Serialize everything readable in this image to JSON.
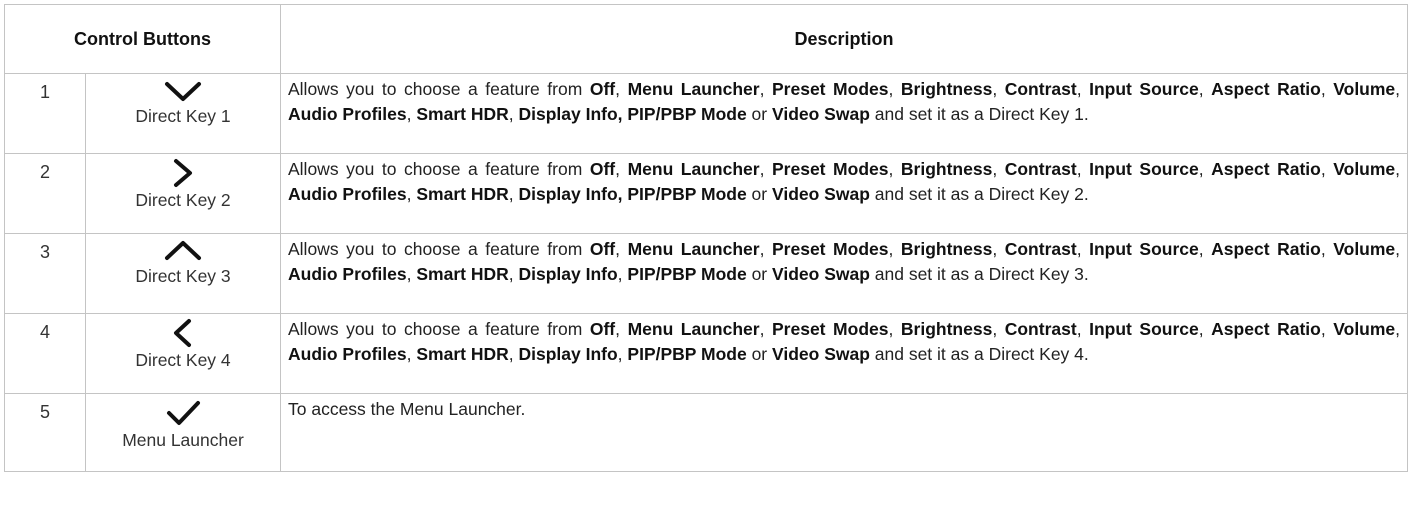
{
  "header": {
    "col_buttons": "Control Buttons",
    "col_description": "Description"
  },
  "rows": [
    {
      "num": "1",
      "icon": "chevron-down-icon",
      "button_label": "Direct Key 1",
      "prefix": "Allows you to choose a feature from ",
      "f1": "Off",
      "f2": "Menu Launcher",
      "f3": "Preset Modes",
      "f4": "Brightness",
      "f5": "Contrast",
      "f6": "Input Source",
      "f7": "Aspect Ratio",
      "f8": "Volume",
      "f9": "Audio Profiles",
      "f10": "Smart HDR",
      "f11": "Display Info, PIP/PBP Mode",
      "f12": "Video Swap",
      "suffix": " and set it as a Direct Key 1."
    },
    {
      "num": "2",
      "icon": "chevron-right-icon",
      "button_label": "Direct Key 2",
      "prefix": "Allows you to choose a feature from ",
      "f1": "Off",
      "f2": "Menu Launcher",
      "f3": "Preset Modes",
      "f4": "Brightness",
      "f5": "Contrast",
      "f6": "Input Source",
      "f7": "Aspect Ratio",
      "f8": "Volume",
      "f9": "Audio Profiles",
      "f10": "Smart HDR",
      "f11": "Display Info, PIP/PBP Mode",
      "f12": "Video Swap",
      "suffix": " and set it as a Direct Key 2."
    },
    {
      "num": "3",
      "icon": "chevron-up-icon",
      "button_label": "Direct Key 3",
      "prefix": "Allows you to choose a feature from ",
      "f1": "Off",
      "f2": "Menu Launcher",
      "f3": "Preset Modes",
      "f4": "Brightness",
      "f5": "Contrast",
      "f6": "Input Source",
      "f7": "Aspect Ratio",
      "f8": "Volume",
      "f9": "Audio Profiles",
      "f10": "Smart HDR",
      "f11": "Display Info",
      "f11b": "PIP/PBP Mode",
      "f12": "Video Swap",
      "suffix": " and set it as a Direct Key 3."
    },
    {
      "num": "4",
      "icon": "chevron-left-icon",
      "button_label": "Direct Key 4",
      "prefix": "Allows you to choose a feature from ",
      "f1": "Off",
      "f2": "Menu Launcher",
      "f3": "Preset Modes",
      "f4": "Brightness",
      "f5": "Contrast",
      "f6": "Input Source",
      "f7": "Aspect Ratio",
      "f8": "Volume",
      "f9": "Audio Profiles",
      "f10": "Smart HDR",
      "f11": "Display Info",
      "f11b": "PIP/PBP Mode",
      "f12": "Video Swap",
      "suffix": " and set it as a Direct Key 4."
    },
    {
      "num": "5",
      "icon": "checkmark-icon",
      "button_label": "Menu Launcher",
      "desc": "To access the Menu Launcher."
    }
  ]
}
